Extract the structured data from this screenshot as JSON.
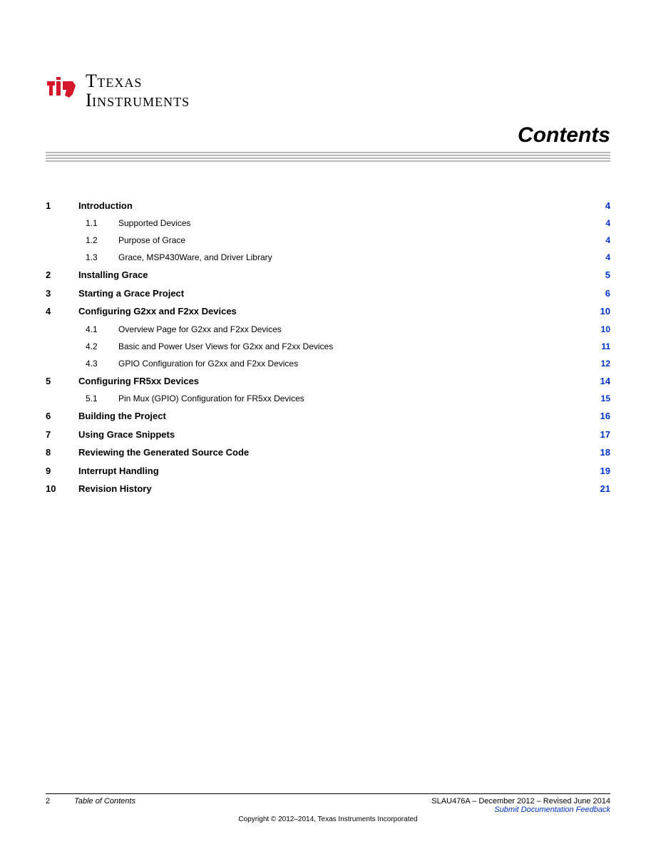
{
  "logo": {
    "top": "TEXAS",
    "bottom": "INSTRUMENTS"
  },
  "title": "Contents",
  "toc": [
    {
      "num": "1",
      "label": "Introduction",
      "page": "4",
      "level": 1
    },
    {
      "num": "1.1",
      "label": "Supported Devices",
      "page": "4",
      "level": 2
    },
    {
      "num": "1.2",
      "label": "Purpose of Grace",
      "page": "4",
      "level": 2
    },
    {
      "num": "1.3",
      "label": "Grace, MSP430Ware, and Driver Library",
      "page": "4",
      "level": 2
    },
    {
      "num": "2",
      "label": "Installing Grace",
      "page": "5",
      "level": 1
    },
    {
      "num": "3",
      "label": "Starting a Grace Project",
      "page": "6",
      "level": 1
    },
    {
      "num": "4",
      "label": "Configuring G2xx and F2xx Devices",
      "page": "10",
      "level": 1
    },
    {
      "num": "4.1",
      "label": "Overview Page for G2xx and F2xx Devices",
      "page": "10",
      "level": 2
    },
    {
      "num": "4.2",
      "label": "Basic and Power User Views for G2xx and F2xx Devices",
      "page": "11",
      "level": 2
    },
    {
      "num": "4.3",
      "label": "GPIO Configuration for G2xx and F2xx Devices",
      "page": "12",
      "level": 2
    },
    {
      "num": "5",
      "label": "Configuring FR5xx Devices",
      "page": "14",
      "level": 1
    },
    {
      "num": "5.1",
      "label": "Pin Mux (GPIO) Configuration for FR5xx Devices",
      "page": "15",
      "level": 2
    },
    {
      "num": "6",
      "label": "Building the Project",
      "page": "16",
      "level": 1
    },
    {
      "num": "7",
      "label": "Using Grace Snippets",
      "page": "17",
      "level": 1
    },
    {
      "num": "8",
      "label": "Reviewing the Generated Source Code",
      "page": "18",
      "level": 1
    },
    {
      "num": "9",
      "label": "Interrupt Handling",
      "page": "19",
      "level": 1
    },
    {
      "num": "10",
      "label": "Revision History",
      "page": "21",
      "level": 1
    }
  ],
  "footer": {
    "page_number": "2",
    "section_title": "Table of Contents",
    "doc_id": "SLAU476A – December 2012 – Revised June 2014",
    "link_text": "Submit Documentation Feedback",
    "copyright": "Copyright © 2012–2014, Texas Instruments Incorporated"
  }
}
